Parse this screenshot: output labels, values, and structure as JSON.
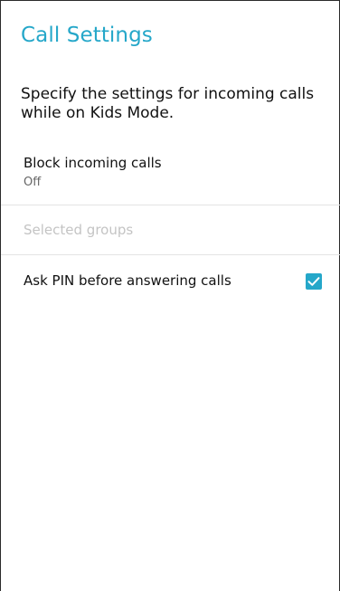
{
  "header": {
    "title": "Call Settings"
  },
  "description": "Specify the settings for incoming calls while on Kids Mode.",
  "settings": {
    "block_incoming": {
      "label": "Block incoming calls",
      "value": "Off"
    },
    "selected_groups": {
      "label": "Selected groups",
      "enabled": false
    },
    "ask_pin": {
      "label": "Ask PIN before answering calls",
      "checked": true
    }
  },
  "colors": {
    "accent": "#25a7c9",
    "text_primary": "#111111",
    "text_secondary": "#666666",
    "text_disabled": "#c4c4c4",
    "divider": "#e3e3e3"
  },
  "icons": {
    "checkbox": "check-icon"
  }
}
